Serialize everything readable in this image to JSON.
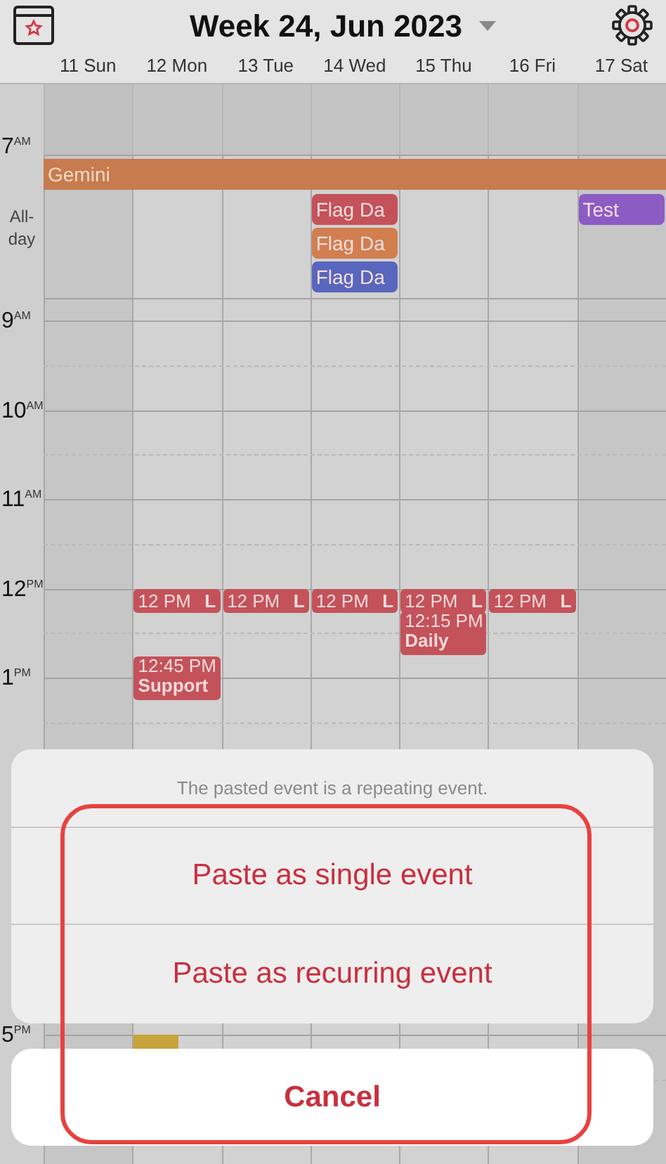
{
  "header": {
    "title": "Week 24, Jun 2023"
  },
  "days": [
    {
      "label": "11 Sun",
      "weekend": true
    },
    {
      "label": "12 Mon",
      "weekend": false,
      "events": [
        {
          "kind": "inline",
          "time": "12 PM",
          "title": "L",
          "color": "#c4525a"
        },
        {
          "kind": "stacked",
          "time": "12:45 PM",
          "title": "Support",
          "color": "#c4525a"
        },
        {
          "kind": "block",
          "color": "#c9a43a"
        }
      ]
    },
    {
      "label": "13 Tue",
      "weekend": false,
      "events": [
        {
          "kind": "inline",
          "time": "12 PM",
          "title": "L",
          "color": "#c4525a"
        }
      ]
    },
    {
      "label": "14 Wed",
      "weekend": false,
      "all_day": [
        {
          "title": "Flag Da",
          "color": "#c4525a"
        },
        {
          "title": "Flag Da",
          "color": "#d17f4f"
        },
        {
          "title": "Flag Da",
          "color": "#5966bd"
        }
      ],
      "events": [
        {
          "kind": "inline",
          "time": "12 PM",
          "title": "L",
          "color": "#c4525a"
        }
      ]
    },
    {
      "label": "15 Thu",
      "weekend": false,
      "events": [
        {
          "kind": "inline",
          "time": "12 PM",
          "title": "L",
          "color": "#c4525a"
        },
        {
          "kind": "stacked",
          "time": "12:15 PM",
          "title": "Daily",
          "color": "#c4525a"
        }
      ]
    },
    {
      "label": "16 Fri",
      "weekend": false,
      "events": [
        {
          "kind": "inline",
          "time": "12 PM",
          "title": "L",
          "color": "#c4525a"
        }
      ]
    },
    {
      "label": "17 Sat",
      "weekend": true,
      "all_day": [
        {
          "title": "Test",
          "color": "#8c5bc4"
        }
      ]
    }
  ],
  "multi_day": [
    {
      "title": "Gemini",
      "color": "#c77b4f"
    }
  ],
  "first_hour": {
    "hour": "7",
    "ampm": "AM"
  },
  "all_day_label": "All-day",
  "hours": [
    {
      "hour": "9",
      "ampm": "AM"
    },
    {
      "hour": "10",
      "ampm": "AM"
    },
    {
      "hour": "11",
      "ampm": "AM"
    },
    {
      "hour": "12",
      "ampm": "PM"
    },
    {
      "hour": "1",
      "ampm": "PM"
    },
    {
      "hour": "5",
      "ampm": "PM"
    }
  ],
  "action_sheet": {
    "message": "The pasted event is a repeating event.",
    "actions": [
      "Paste as single event",
      "Paste as recurring event"
    ],
    "cancel": "Cancel"
  },
  "annotation": {
    "kind": "outline"
  }
}
